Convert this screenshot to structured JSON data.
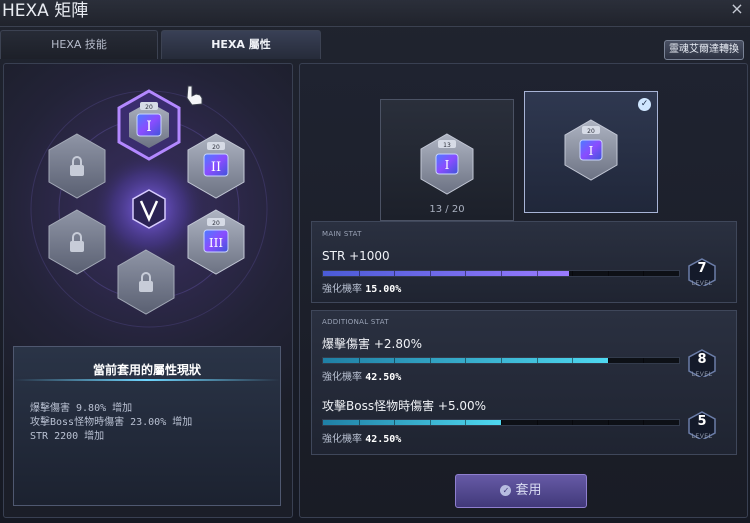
{
  "window": {
    "title": "HEXA 矩陣",
    "close_label": "×"
  },
  "tabs": [
    {
      "label": "HEXA 技能",
      "active": false
    },
    {
      "label": "HEXA 屬性",
      "active": true
    }
  ],
  "soul_button": "靈魂艾爾達轉換",
  "matrix": {
    "center_icon": "hexa-v-emblem-icon",
    "nodes": [
      {
        "level": "20",
        "numeral": "I",
        "state": "selected"
      },
      {
        "level": "20",
        "numeral": "II",
        "state": "unlocked"
      },
      {
        "level": "20",
        "numeral": "III",
        "state": "unlocked"
      },
      {
        "state": "locked"
      },
      {
        "state": "locked"
      },
      {
        "state": "locked"
      }
    ]
  },
  "status": {
    "title": "當前套用的屬性現狀",
    "items": [
      "爆擊傷害 9.80% 增加",
      "攻擊Boss怪物時傷害 23.00% 增加",
      "STR 2200 增加"
    ]
  },
  "preview": {
    "current": {
      "level": "13",
      "numeral": "I",
      "level_text": "13 / 20"
    },
    "next": {
      "level": "20",
      "numeral": "I",
      "selected": true
    }
  },
  "main_stat": {
    "label": "MAIN STAT",
    "name": "STR +1000",
    "prob_label": "強化機率",
    "prob_value": "15.00%",
    "level": "7",
    "level_word": "LEVEL",
    "fill": 0.69
  },
  "additional": {
    "label": "ADDITIONAL STAT",
    "stats": [
      {
        "name": "爆擊傷害 +2.80%",
        "prob_label": "強化機率",
        "prob_value": "42.50%",
        "level": "8",
        "level_word": "LEVEL",
        "fill": 0.8
      },
      {
        "name": "攻擊Boss怪物時傷害 +5.00%",
        "prob_label": "強化機率",
        "prob_value": "42.50%",
        "level": "5",
        "level_word": "LEVEL",
        "fill": 0.5
      }
    ]
  },
  "apply_button": "套用",
  "colors": {
    "accent": "#7b5cf0",
    "cyan": "#35c8e8",
    "purple_bar": "#7d6df0"
  }
}
